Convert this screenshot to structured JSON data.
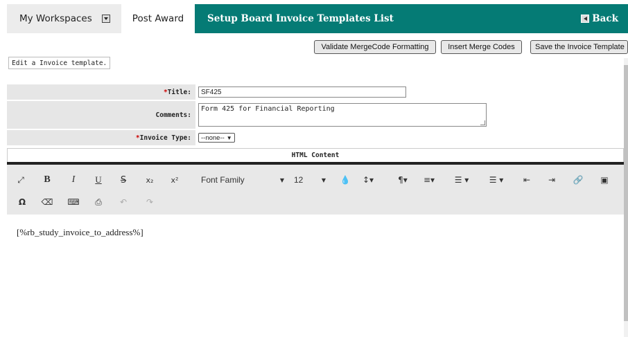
{
  "nav": {
    "workspaces_label": "My Workspaces",
    "post_award_label": "Post Award",
    "page_title": "Setup Board Invoice Templates List",
    "back_label": "Back"
  },
  "actions": {
    "validate_label": "Validate MergeCode Formatting",
    "insert_label": "Insert Merge Codes",
    "save_label": "Save the Invoice Template"
  },
  "hint_text": "Edit a Invoice template.",
  "form": {
    "title_label": "Title:",
    "title_value": "SF425",
    "comments_label": "Comments:",
    "comments_value": "Form 425 for Financial Reporting",
    "invoice_type_label": "Invoice Type:",
    "invoice_type_value": "--none--",
    "required_mark": "*"
  },
  "editor": {
    "section_header": "HTML Content",
    "font_family_label": "Font Family",
    "font_size_value": "12",
    "content": "[%rb_study_invoice_to_address%]"
  },
  "colors": {
    "accent": "#057b75",
    "required": "#cc0000",
    "label_bg": "#e6e6e6",
    "toolbar_bg": "#e8e8e8"
  }
}
